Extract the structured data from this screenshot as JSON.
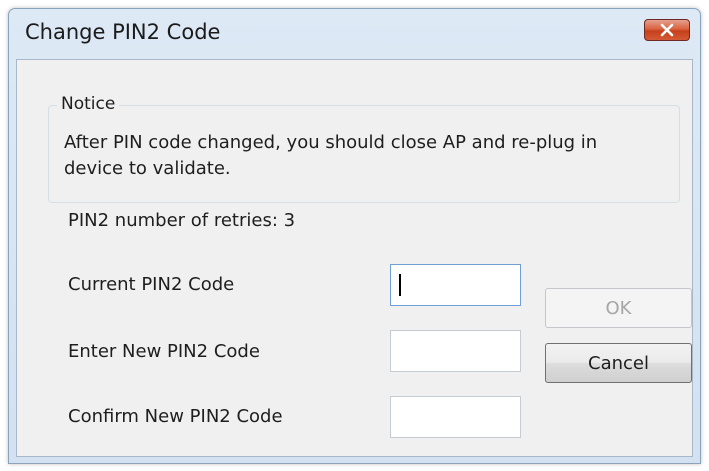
{
  "window": {
    "title": "Change PIN2 Code"
  },
  "notice": {
    "legend": "Notice",
    "text": "After PIN code changed, you should close AP and re-plug in device to validate."
  },
  "retries_label": "PIN2 number of retries: 3",
  "fields": {
    "current": {
      "label": "Current PIN2 Code",
      "value": ""
    },
    "new": {
      "label": "Enter New PIN2 Code",
      "value": ""
    },
    "confirm": {
      "label": "Confirm New PIN2 Code",
      "value": ""
    }
  },
  "buttons": {
    "ok": "OK",
    "cancel": "Cancel"
  },
  "colors": {
    "close_button": "#c7401c",
    "client_bg": "#f0f0f0",
    "titlebar": "#d3e1f0"
  },
  "icons": {
    "close": "close-icon"
  }
}
